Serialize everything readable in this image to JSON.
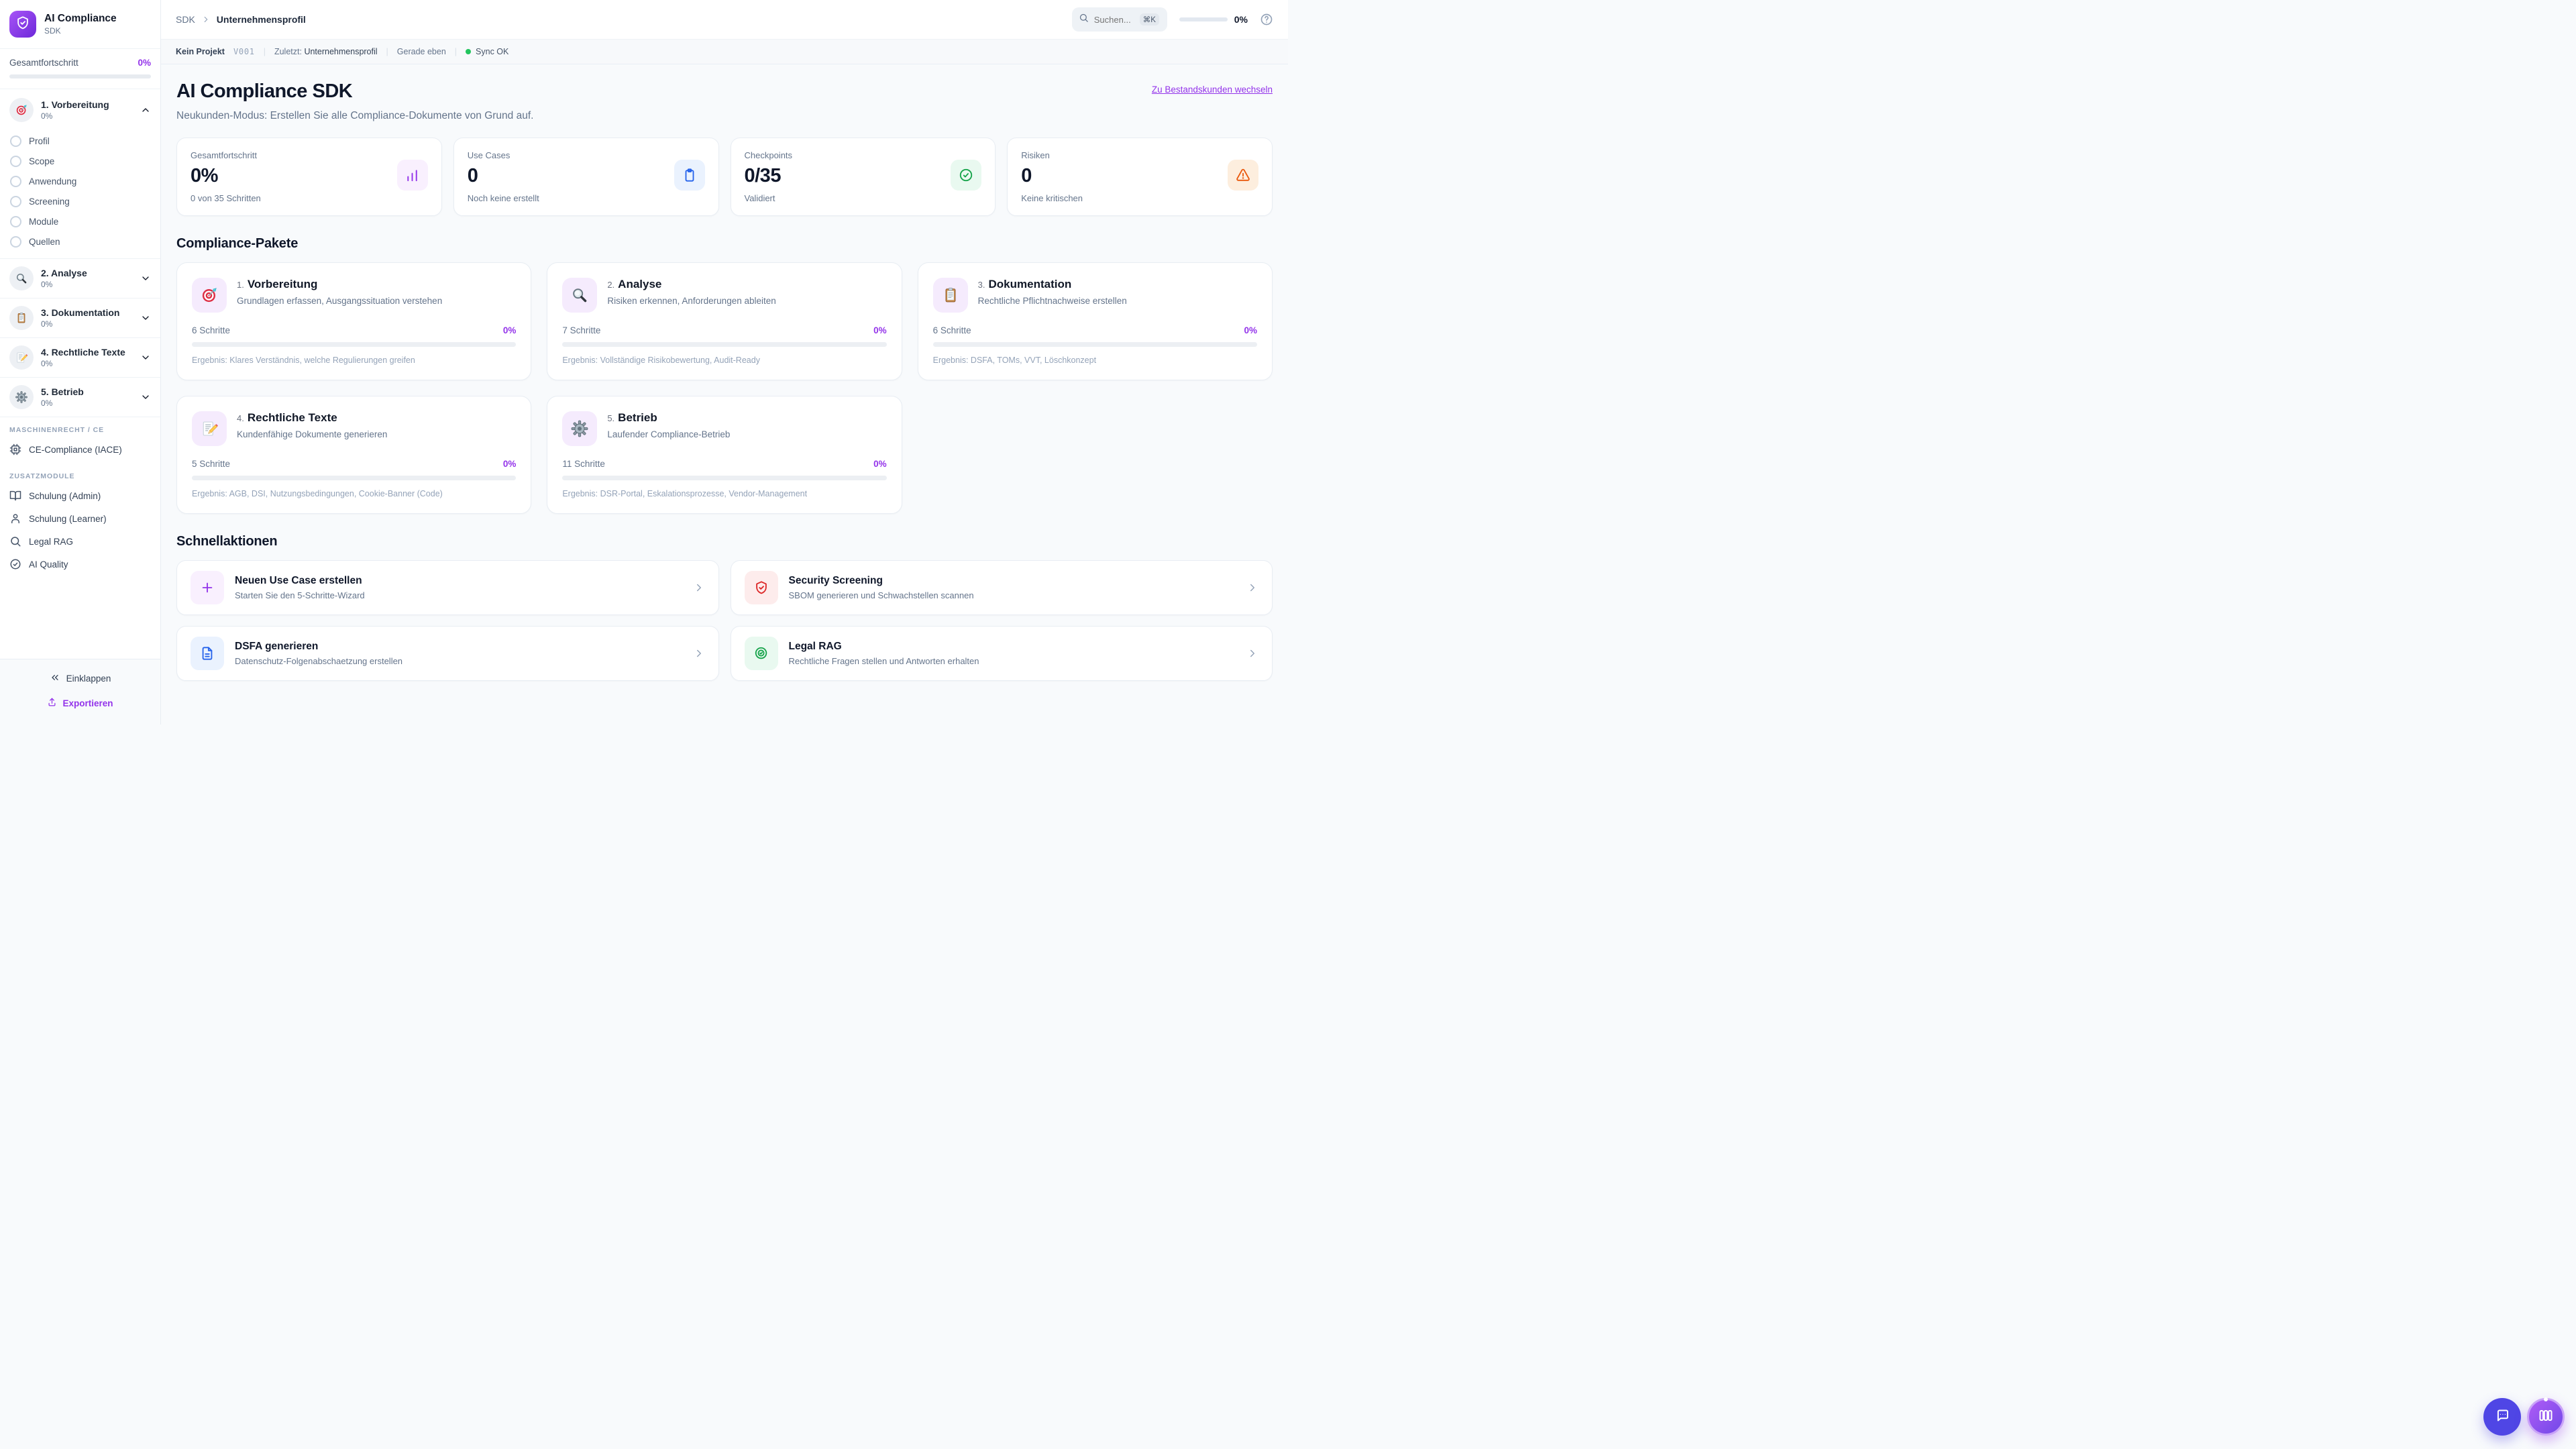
{
  "app": {
    "name": "AI Compliance",
    "subtitle": "SDK"
  },
  "colors": {
    "accent": "#9333ea",
    "sync_ok": "#22c55e",
    "info": "#2563eb",
    "success": "#16a34a",
    "warning": "#ea580c",
    "danger": "#dc2626",
    "fab_chat": "#4f46e5"
  },
  "sidebar": {
    "overall_label": "Gesamtfortschritt",
    "overall_percent": "0%",
    "sections": [
      {
        "label": "1. Vorbereitung",
        "percent": "0%",
        "icon": "target-emoji",
        "items": [
          "Profil",
          "Scope",
          "Anwendung",
          "Screening",
          "Module",
          "Quellen"
        ]
      },
      {
        "label": "2. Analyse",
        "percent": "0%",
        "icon": "magnifier-emoji"
      },
      {
        "label": "3. Dokumentation",
        "percent": "0%",
        "icon": "clipboard-emoji"
      },
      {
        "label": "4. Rechtliche Texte",
        "percent": "0%",
        "icon": "memo-emoji"
      },
      {
        "label": "5. Betrieb",
        "percent": "0%",
        "icon": "gear-emoji"
      }
    ],
    "machine_group_label": "MASCHINENRECHT / CE",
    "machine_item": "CE-Compliance (IACE)",
    "modules_group_label": "ZUSATZMODULE",
    "module_items": [
      "Schulung (Admin)",
      "Schulung (Learner)",
      "Legal RAG",
      "AI Quality"
    ],
    "collapse_label": "Einklappen",
    "export_label": "Exportieren"
  },
  "topbar": {
    "breadcrumb_root": "SDK",
    "breadcrumb_current": "Unternehmensprofil",
    "search_placeholder": "Suchen...",
    "search_shortcut": "⌘K",
    "progress_percent": "0%"
  },
  "statusbar": {
    "project": "Kein Projekt",
    "version": "V001",
    "last_label": "Zuletzt:",
    "last_value": "Unternehmensprofil",
    "time": "Gerade eben",
    "sync": "Sync OK"
  },
  "hero": {
    "title": "AI Compliance SDK",
    "subtitle": "Neukunden-Modus: Erstellen Sie alle Compliance-Dokumente von Grund auf.",
    "switch_link": "Zu Bestandskunden wechseln"
  },
  "stats": [
    {
      "label": "Gesamtfortschritt",
      "value": "0%",
      "sub": "0 von 35 Schritten",
      "icon": "bar-chart"
    },
    {
      "label": "Use Cases",
      "value": "0",
      "sub": "Noch keine erstellt",
      "icon": "clipboard"
    },
    {
      "label": "Checkpoints",
      "value": "0/35",
      "sub": "Validiert",
      "icon": "check-circle"
    },
    {
      "label": "Risiken",
      "value": "0",
      "sub": "Keine kritischen",
      "icon": "alert-triangle"
    }
  ],
  "packages": {
    "heading": "Compliance-Pakete",
    "cards": [
      {
        "num": "1.",
        "title": "Vorbereitung",
        "desc": "Grundlagen erfassen, Ausgangssituation verstehen",
        "steps": "6 Schritte",
        "percent": "0%",
        "result": "Ergebnis: Klares Verständnis, welche Regulierungen greifen",
        "icon": "target-emoji"
      },
      {
        "num": "2.",
        "title": "Analyse",
        "desc": "Risiken erkennen, Anforderungen ableiten",
        "steps": "7 Schritte",
        "percent": "0%",
        "result": "Ergebnis: Vollständige Risikobewertung, Audit-Ready",
        "icon": "magnifier-emoji"
      },
      {
        "num": "3.",
        "title": "Dokumentation",
        "desc": "Rechtliche Pflichtnachweise erstellen",
        "steps": "6 Schritte",
        "percent": "0%",
        "result": "Ergebnis: DSFA, TOMs, VVT, Löschkonzept",
        "icon": "clipboard-emoji"
      },
      {
        "num": "4.",
        "title": "Rechtliche Texte",
        "desc": "Kundenfähige Dokumente generieren",
        "steps": "5 Schritte",
        "percent": "0%",
        "result": "Ergebnis: AGB, DSI, Nutzungsbedingungen, Cookie-Banner (Code)",
        "icon": "memo-emoji"
      },
      {
        "num": "5.",
        "title": "Betrieb",
        "desc": "Laufender Compliance-Betrieb",
        "steps": "11 Schritte",
        "percent": "0%",
        "result": "Ergebnis: DSR-Portal, Eskalationsprozesse, Vendor-Management",
        "icon": "gear-emoji"
      }
    ]
  },
  "actions": {
    "heading": "Schnellaktionen",
    "items": [
      {
        "title": "Neuen Use Case erstellen",
        "sub": "Starten Sie den 5-Schritte-Wizard",
        "icon": "plus"
      },
      {
        "title": "Security Screening",
        "sub": "SBOM generieren und Schwachstellen scannen",
        "icon": "shield-check"
      },
      {
        "title": "DSFA generieren",
        "sub": "Datenschutz-Folgenabschaetzung erstellen",
        "icon": "file-text"
      },
      {
        "title": "Legal RAG",
        "sub": "Rechtliche Fragen stellen und Antworten erhalten",
        "icon": "search-check"
      }
    ]
  }
}
